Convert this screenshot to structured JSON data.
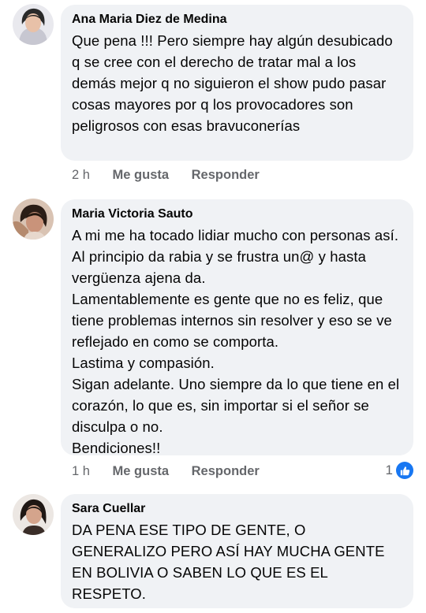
{
  "comments": [
    {
      "author": "Ana Maria Diez de Medina",
      "text": "Que pena !!! Pero siempre hay algún desubicado q se cree con el derecho de tratar mal a los demás mejor q no siguieron el show pudo pasar cosas mayores por q los provocadores son peligrosos con esas bravuconerías",
      "time": "2 h",
      "like_label": "Me gusta",
      "reply_label": "Responder"
    },
    {
      "author": "Maria Victoria Sauto",
      "text": "A mi me ha tocado lidiar mucho con personas así. Al principio da rabia y se frustra un@ y hasta vergüenza ajena da.\nLamentablemente es gente que no es feliz, que tiene problemas internos sin resolver y eso se ve reflejado en como se comporta.\nLastima y compasión.\nSigan adelante. Uno siempre da lo que tiene en el corazón, lo que es, sin importar si el señor se disculpa o no.\nBendiciones!!",
      "time": "1 h",
      "like_label": "Me gusta",
      "reply_label": "Responder",
      "reaction_count": "1"
    },
    {
      "author": "Sara Cuellar",
      "text": "DA PENA ESE TIPO DE GENTE, O GENERALIZO PERO ASÍ HAY MUCHA GENTE EN BOLIVIA O SABEN LO QUE ES EL RESPETO."
    }
  ],
  "colors": {
    "bubble": "#f0f2f5",
    "meta_text": "#65676b",
    "like_badge": "#1877f2"
  }
}
